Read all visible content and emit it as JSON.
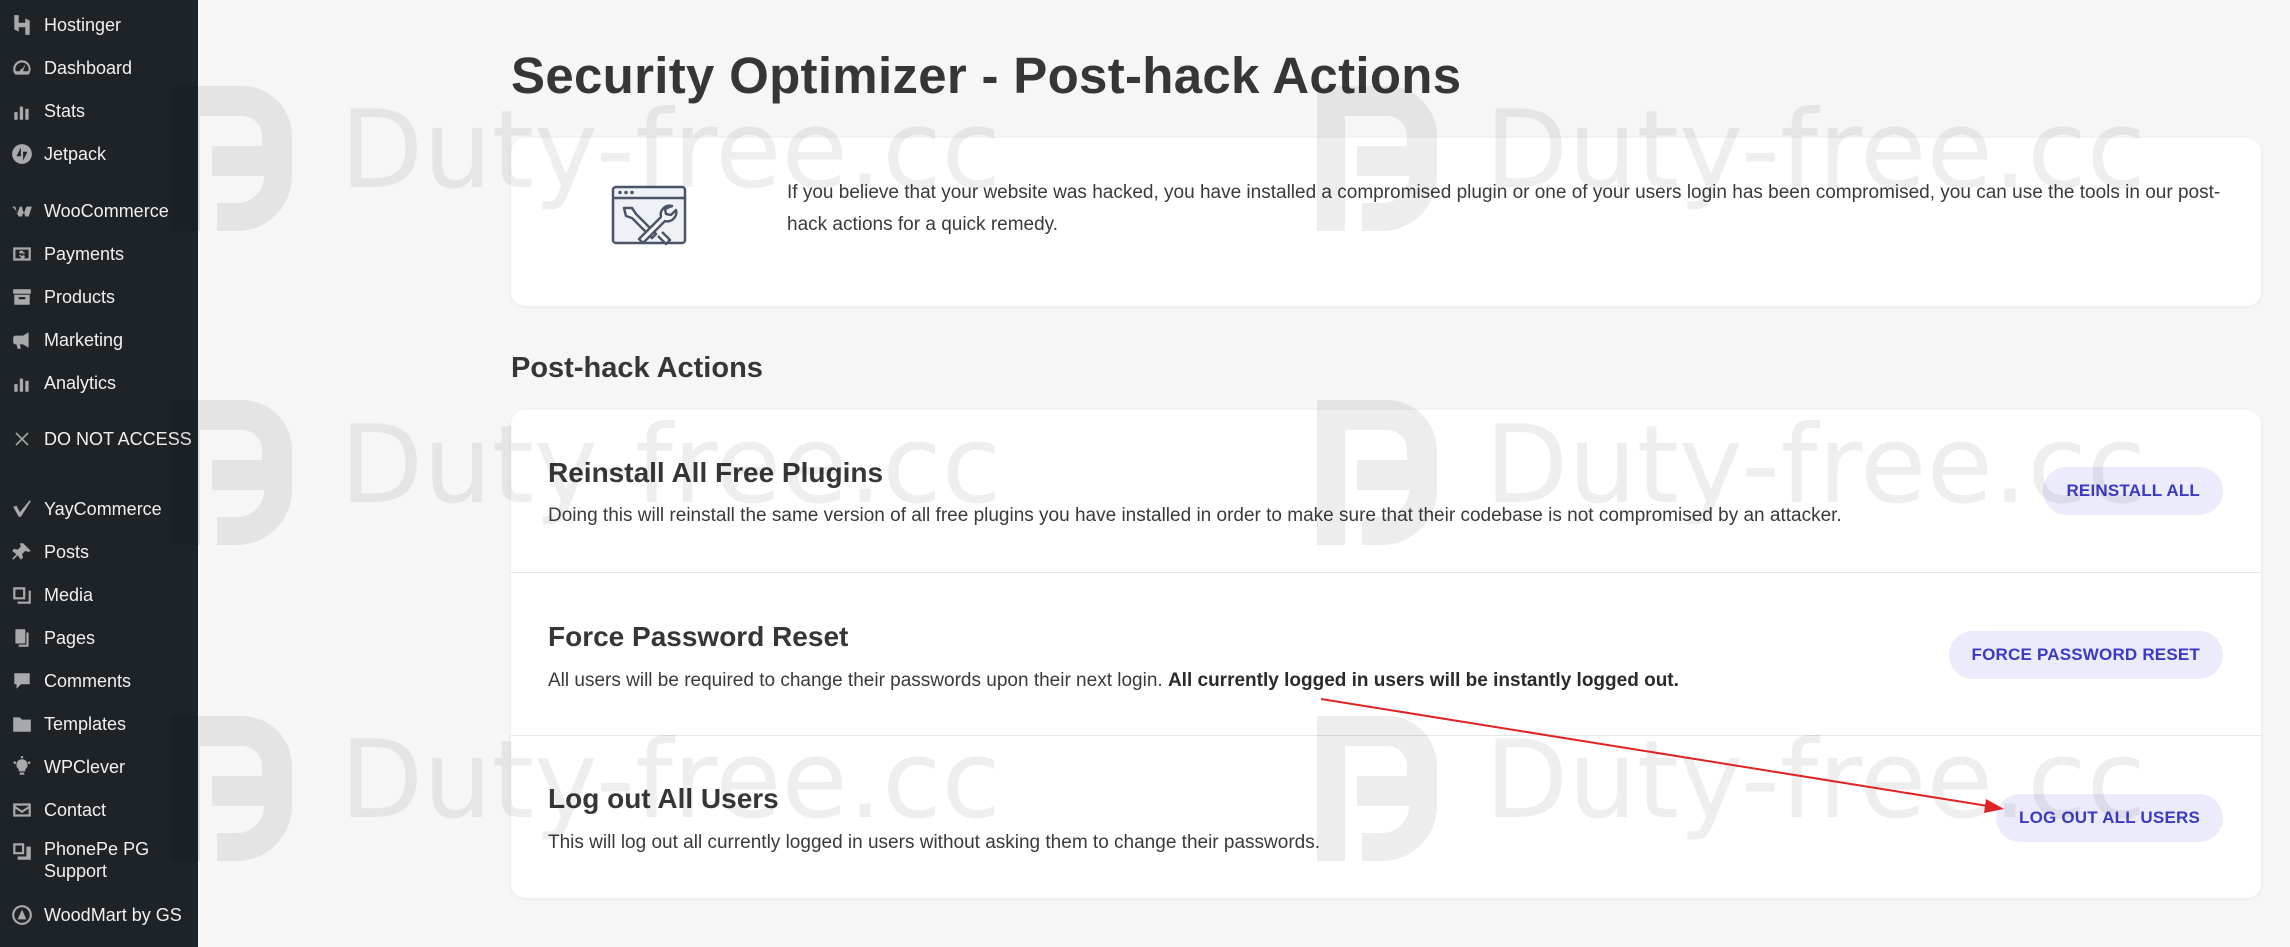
{
  "sidebar": {
    "items": [
      {
        "label": "Hostinger",
        "icon": "hostinger-icon"
      },
      {
        "label": "Dashboard",
        "icon": "dashboard-icon"
      },
      {
        "label": "Stats",
        "icon": "stats-icon"
      },
      {
        "label": "Jetpack",
        "icon": "jetpack-icon"
      },
      {
        "label": "WooCommerce",
        "icon": "woocommerce-icon"
      },
      {
        "label": "Payments",
        "icon": "payments-icon"
      },
      {
        "label": "Products",
        "icon": "products-icon"
      },
      {
        "label": "Marketing",
        "icon": "megaphone-icon"
      },
      {
        "label": "Analytics",
        "icon": "analytics-icon"
      },
      {
        "label": "DO NOT ACCESS",
        "icon": "close-icon"
      },
      {
        "label": "YayCommerce",
        "icon": "yaycommerce-icon"
      },
      {
        "label": "Posts",
        "icon": "pin-icon"
      },
      {
        "label": "Media",
        "icon": "media-icon"
      },
      {
        "label": "Pages",
        "icon": "pages-icon"
      },
      {
        "label": "Comments",
        "icon": "comments-icon"
      },
      {
        "label": "Templates",
        "icon": "folder-icon"
      },
      {
        "label": "WPClever",
        "icon": "lightbulb-icon"
      },
      {
        "label": "Contact",
        "icon": "mail-icon"
      },
      {
        "label": "PhonePe PG Support",
        "label_line1": "PhonePe PG",
        "label_line2": "Support",
        "icon": "phonepe-icon"
      },
      {
        "label": "WoodMart by GS",
        "icon": "woodmart-icon"
      }
    ]
  },
  "main": {
    "title": "Security Optimizer - Post-hack Actions",
    "intro_text": "If you believe that your website was hacked, you have installed a compromised plugin or one of your users login has been compromised, you can use the tools in our post-hack actions for a quick remedy.",
    "section_title": "Post-hack Actions",
    "actions": [
      {
        "title": "Reinstall All Free Plugins",
        "desc": "Doing this will reinstall the same version of all free plugins you have installed in order to make sure that their codebase is not compromised by an attacker.",
        "button": "REINSTALL ALL"
      },
      {
        "title": "Force Password Reset",
        "desc": "All users will be required to change their passwords upon their next login.",
        "desc_bold": "All currently logged in users will be instantly logged out.",
        "button": "FORCE PASSWORD RESET"
      },
      {
        "title": "Log out All Users",
        "desc": "This will log out all currently logged in users without asking them to change their passwords.",
        "button": "LOG OUT ALL USERS"
      }
    ]
  },
  "watermark": {
    "text": "Duty-free.cc"
  },
  "colors": {
    "sidebar_bg": "#1d2327",
    "page_bg": "#f6f6f6",
    "button_bg": "#ebebfb",
    "button_text": "#3a3ac5",
    "annotation_arrow": "#e02424"
  }
}
